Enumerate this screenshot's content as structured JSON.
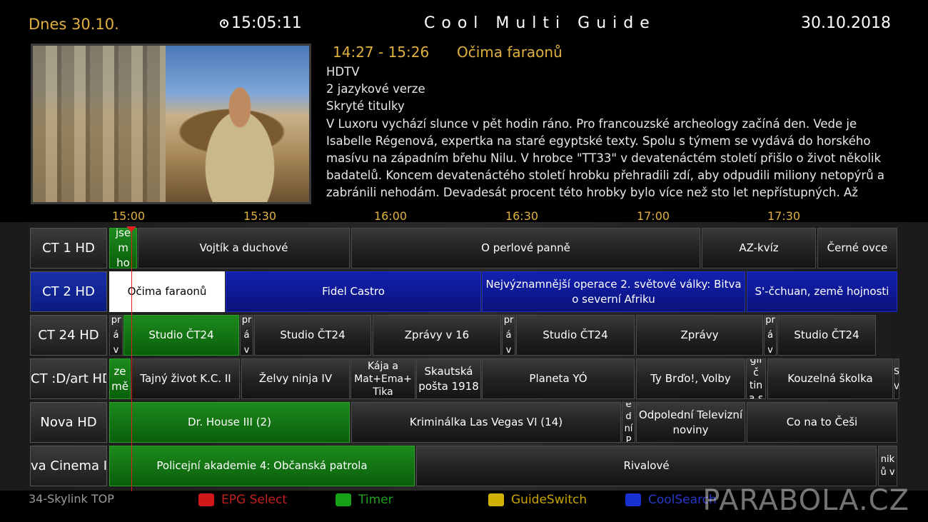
{
  "header": {
    "day": "Dnes  30.10.",
    "clock": "15:05:11",
    "title": "Cool Multi Guide",
    "date": "30.10.2018"
  },
  "program": {
    "time": "14:27 - 15:26",
    "title": "Očima faraonů",
    "line1": "HDTV",
    "line2": "2 jazykové verze",
    "line3": "Skryté titulky",
    "description": "V Luxoru vychází slunce v pět hodin ráno. Pro francouzské archeology začíná den. Vede je Isabelle Régenová, expertka na staré egyptské texty. Spolu s týmem se vydává do horského masívu na západním břehu Nilu. V hrobce \"TT33\" v devatenáctém století přišlo o život několik badatelů. Koncem devatenáctého století hrobku přehradili zdí, aby odpudili miliony netopýrů a zabránili nehodám. Devadesát procent této hrobky bylo více než sto let nepřístupných. Až"
  },
  "timeline": [
    "15:00",
    "15:30",
    "16:00",
    "16:30",
    "17:00",
    "17:30"
  ],
  "channels": [
    {
      "name": "CT 1 HD",
      "selected": false,
      "events": [
        {
          "title": "jsem ho",
          "style": "green"
        },
        {
          "title": "Vojtík a duchové",
          "style": "normal"
        },
        {
          "title": "O perlové panně",
          "style": "normal"
        },
        {
          "title": "AZ-kvíz",
          "style": "normal"
        },
        {
          "title": "Černé ovce",
          "style": "normal"
        }
      ]
    },
    {
      "name": "CT 2 HD",
      "selected": true,
      "events": [
        {
          "title": "Očima faraonů",
          "style": "white"
        },
        {
          "title": "Fidel Castro",
          "style": "blue"
        },
        {
          "title": "Nejvýznamnější operace 2. světové války: Bitva o severní Afriku",
          "style": "blue"
        },
        {
          "title": "S'-čchuan, země hojnosti",
          "style": "blue"
        }
      ]
    },
    {
      "name": "CT 24 HD",
      "selected": false,
      "events": [
        {
          "title": "pr áv",
          "style": "normal"
        },
        {
          "title": "Studio ČT24",
          "style": "green"
        },
        {
          "title": "pr áv",
          "style": "normal"
        },
        {
          "title": "Studio ČT24",
          "style": "normal"
        },
        {
          "title": "Zprávy v 16",
          "style": "normal"
        },
        {
          "title": "pr áv",
          "style": "normal"
        },
        {
          "title": "Studio ČT24",
          "style": "normal"
        },
        {
          "title": "Zprávy",
          "style": "normal"
        },
        {
          "title": "pr áv",
          "style": "normal"
        },
        {
          "title": "Studio ČT24",
          "style": "normal"
        }
      ]
    },
    {
      "name": "CT :D/art HD",
      "selected": false,
      "events": [
        {
          "title": "ze mě",
          "style": "green"
        },
        {
          "title": "Tajný život K.C. II",
          "style": "normal"
        },
        {
          "title": "Želvy ninja IV",
          "style": "normal"
        },
        {
          "title": "Kája a Mat+Ema+ Tika",
          "style": "normal"
        },
        {
          "title": "Skautská pošta 1918",
          "style": "normal"
        },
        {
          "title": "Planeta YÓ",
          "style": "normal"
        },
        {
          "title": "Ty Brďo!, Volby",
          "style": "normal"
        },
        {
          "title": "glič tin a s",
          "style": "normal"
        },
        {
          "title": "Kouzelná školka",
          "style": "normal"
        },
        {
          "title": "S V",
          "style": "normal"
        }
      ]
    },
    {
      "name": "Nova HD",
      "selected": false,
      "events": [
        {
          "title": "Dr. House III (2)",
          "style": "green"
        },
        {
          "title": "Kriminálka Las Vegas VI (14)",
          "style": "normal"
        },
        {
          "title": "ed ní P",
          "style": "normal"
        },
        {
          "title": "Odpolední Televizní noviny",
          "style": "normal"
        },
        {
          "title": "Co na to Češi",
          "style": "normal"
        }
      ]
    },
    {
      "name": "va Cinema I",
      "selected": false,
      "events": [
        {
          "title": "Policejní akademie 4: Občanská patrola",
          "style": "green"
        },
        {
          "title": "Rivalové",
          "style": "normal"
        },
        {
          "title": "nik ů v",
          "style": "normal"
        }
      ]
    }
  ],
  "footer": {
    "provider": "34-Skylink TOP",
    "buttons": [
      {
        "label": "EPG Select",
        "color": "#d01818",
        "text_color": "#c02020"
      },
      {
        "label": "Timer",
        "color": "#18a018",
        "text_color": "#20a020"
      },
      {
        "label": "GuideSwitch",
        "color": "#d0b000",
        "text_color": "#c8a400"
      },
      {
        "label": "CoolSearch",
        "color": "#1830d0",
        "text_color": "#2838c8"
      }
    ]
  },
  "watermark": "PARABOLA.CZ"
}
